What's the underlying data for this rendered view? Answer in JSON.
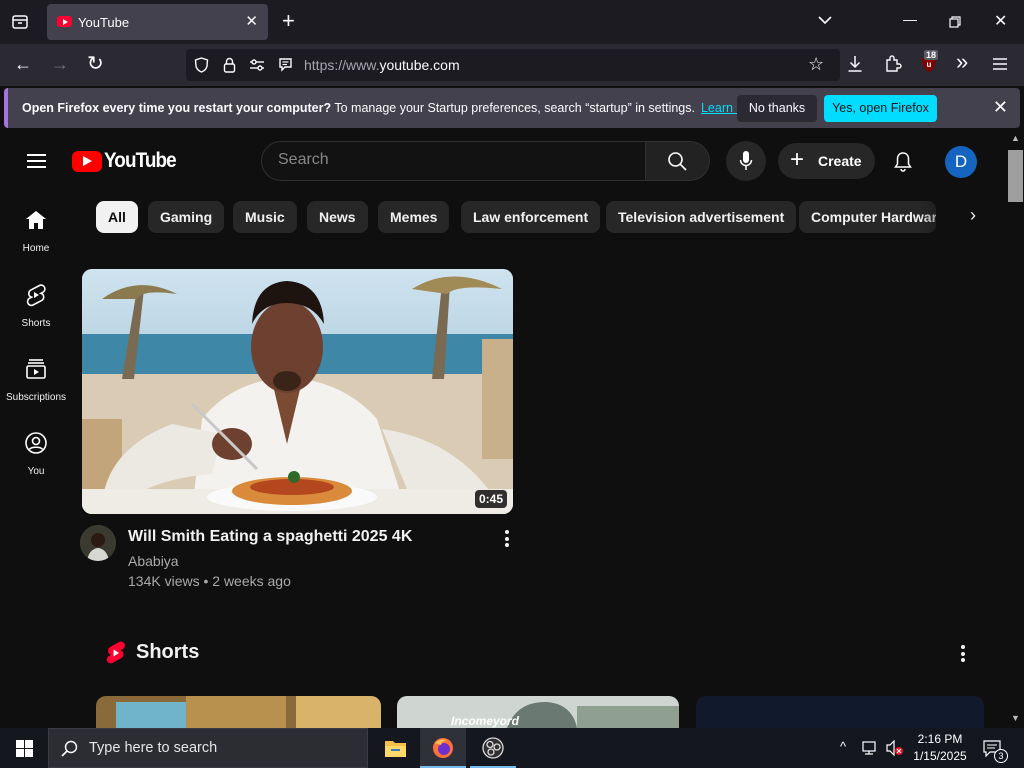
{
  "browser": {
    "tab_title": "YouTube",
    "url_host": "https://www.",
    "url_domain": "youtube.com",
    "extension_badge": "18"
  },
  "notification": {
    "bold_text": "Open Firefox every time you restart your computer?",
    "text": " To manage your Startup preferences, search “startup” in settings.",
    "link": "Learn more",
    "no_thanks": "No thanks",
    "yes_open": "Yes, open Firefox"
  },
  "header": {
    "wordmark": "YouTube",
    "search_placeholder": "Search",
    "create_label": "Create",
    "avatar_letter": "D"
  },
  "sidebar": {
    "items": [
      {
        "label": "Home",
        "icon": "home-icon"
      },
      {
        "label": "Shorts",
        "icon": "shorts-icon"
      },
      {
        "label": "Subscriptions",
        "icon": "subscriptions-icon"
      },
      {
        "label": "You",
        "icon": "you-icon"
      }
    ]
  },
  "chips": [
    "All",
    "Gaming",
    "Music",
    "News",
    "Memes",
    "Law enforcement",
    "Television advertisement",
    "Computer Hardware"
  ],
  "video": {
    "title": "Will Smith Eating a spaghetti 2025 4K",
    "channel": "Ababiya",
    "meta": "134K views • 2 weeks ago",
    "duration": "0:45"
  },
  "shorts": {
    "title": "Shorts",
    "first_overlay_text": "Incomeyord"
  },
  "taskbar": {
    "search_placeholder": "Type here to search",
    "time": "2:16 PM",
    "date": "1/15/2025",
    "notification_count": "3"
  },
  "colors": {
    "yt_red": "#ff0000",
    "firefox_accent": "#00ddff",
    "avatar_blue": "#1565c0"
  }
}
